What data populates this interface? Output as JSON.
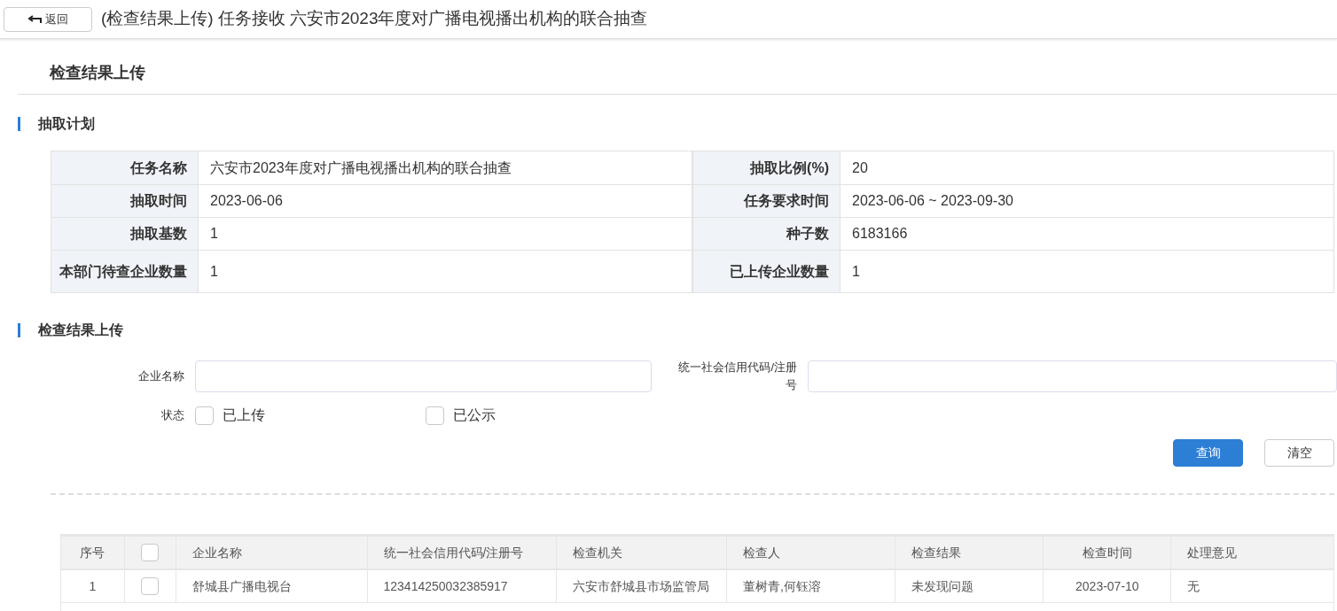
{
  "header": {
    "back_button": "返回",
    "title": "(检查结果上传) 任务接收 六安市2023年度对广播电视播出机构的联合抽查"
  },
  "page_title": "检查结果上传",
  "plan": {
    "heading": "抽取计划",
    "rows": [
      [
        {
          "label": "任务名称",
          "value": "六安市2023年度对广播电视播出机构的联合抽查"
        },
        {
          "label": "抽取比例(%)",
          "value": "20"
        }
      ],
      [
        {
          "label": "抽取时间",
          "value": "2023-06-06"
        },
        {
          "label": "任务要求时间",
          "value": "2023-06-06 ~ 2023-09-30"
        }
      ],
      [
        {
          "label": "抽取基数",
          "value": "1"
        },
        {
          "label": "种子数",
          "value": "6183166"
        }
      ],
      [
        {
          "label": "本部门待查企业数量",
          "value": "1"
        },
        {
          "label": "已上传企业数量",
          "value": "1"
        }
      ]
    ]
  },
  "upload": {
    "heading": "检查结果上传",
    "fields": [
      {
        "label": "企业名称"
      },
      {
        "label": "统一社会信用代码/注册号"
      }
    ],
    "status_label": "状态",
    "status_options": [
      {
        "label": "已上传",
        "checked": false
      },
      {
        "label": "已公示",
        "checked": false
      }
    ],
    "buttons": [
      {
        "label": "查询",
        "kind": "primary"
      },
      {
        "label": "清空",
        "kind": "secondary"
      }
    ]
  },
  "table": {
    "columns": [
      "序号",
      "企业名称",
      "统一社会信用代码/注册号",
      "检查机关",
      "检查人",
      "检查结果",
      "检查时间",
      "处理意见"
    ],
    "select_all_checked": false,
    "rows": [
      {
        "checked": false,
        "cells": [
          "1",
          "舒城县广播电视台",
          "123414250032385917",
          "六安市舒城县市场监管局",
          "董树青,何钰溶",
          "未发现问题",
          "2023-07-10",
          "无"
        ]
      }
    ]
  }
}
